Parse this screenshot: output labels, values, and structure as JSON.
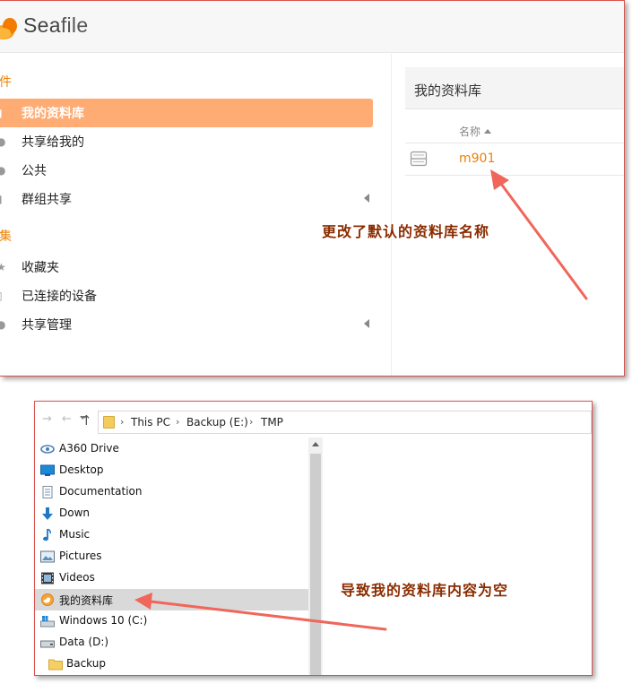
{
  "seafile": {
    "brand_prefix": "Sea",
    "brand_suffix": "file",
    "sidebar": {
      "section1_head": "件",
      "section2_head": "集",
      "items": [
        {
          "label": "我的资料库",
          "active": true,
          "icon": "library-icon"
        },
        {
          "label": "共享给我的",
          "icon": "share-icon"
        },
        {
          "label": "公共",
          "icon": "public-icon"
        },
        {
          "label": "群组共享",
          "icon": "group-icon",
          "expandable": true
        },
        {
          "label": "收藏夹",
          "icon": "star-icon"
        },
        {
          "label": "已连接的设备",
          "icon": "device-icon"
        },
        {
          "label": "共享管理",
          "icon": "share-admin-icon",
          "expandable": true
        }
      ]
    },
    "main": {
      "title": "我的资料库",
      "column_name": "名称",
      "library_name": "m901"
    }
  },
  "annotations": {
    "top": "更改了默认的资料库名称",
    "bottom": "导致我的资料库内容为空"
  },
  "explorer": {
    "breadcrumb": [
      "This PC",
      "Backup (E:)",
      "TMP"
    ],
    "tree": [
      {
        "label": "A360 Drive",
        "icon": "cloud-drive-icon"
      },
      {
        "label": "Desktop",
        "icon": "desktop-icon"
      },
      {
        "label": "Documentation",
        "icon": "document-icon"
      },
      {
        "label": "Down",
        "icon": "download-icon"
      },
      {
        "label": "Music",
        "icon": "music-icon"
      },
      {
        "label": "Pictures",
        "icon": "pictures-icon"
      },
      {
        "label": "Videos",
        "icon": "videos-icon"
      },
      {
        "label": "我的资料库",
        "icon": "seafile-library-icon",
        "selected": true
      },
      {
        "label": "Windows 10 (C:)",
        "icon": "system-drive-icon"
      },
      {
        "label": "Data (D:)",
        "icon": "drive-icon"
      },
      {
        "label": "Backup",
        "icon": "folder-icon",
        "indent": true
      }
    ]
  },
  "colors": {
    "accent_orange": "#eb8205",
    "active_nav": "#feac74",
    "annotation_text": "#8b2c00",
    "annotation_arrow": "#f0665a",
    "frame_border": "#d9534f"
  }
}
